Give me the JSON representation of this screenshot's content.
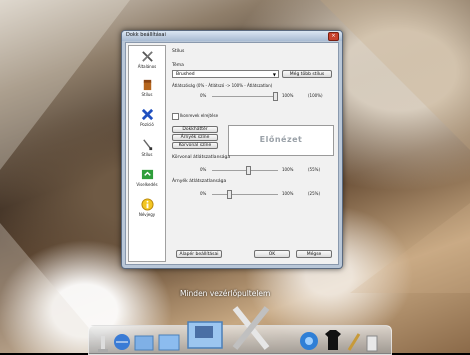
{
  "window": {
    "title": "Dokk beállításai",
    "close_glyph": "×"
  },
  "nav": [
    {
      "label": "Általános",
      "icon": "tools-icon"
    },
    {
      "label": "Stílus",
      "icon": "bucket-icon"
    },
    {
      "label": "Pozíció",
      "icon": "position-icon"
    },
    {
      "label": "Stílus",
      "icon": "brush-icon"
    },
    {
      "label": "Viselkedés",
      "icon": "behavior-icon"
    },
    {
      "label": "Névjegy",
      "icon": "info-icon"
    }
  ],
  "style": {
    "heading": "Stílus",
    "theme_label": "Téma",
    "theme_value": "Brushed",
    "more_styles": "Még több stílus",
    "opacity_label": "Átlátszóság (0% - Átlátszó -> 100% - Átlátszatlan)",
    "opacity_min": "0%",
    "opacity_max": "100%",
    "opacity_value": "(100%)",
    "opacity_fraction": 1.0,
    "dark_icons_label": "Ikonrevek elrejtése",
    "btn_background": "Dokkháttér",
    "btn_shadow": "Árnyék színe",
    "btn_separator": "Korvonal színe",
    "preview": "Előnézet",
    "separator_opacity_label": "Körvonal átlátszatlansága",
    "separator_min": "0%",
    "separator_max": "100%",
    "separator_value": "(55%)",
    "separator_fraction": 0.55,
    "shadow_opacity_label": "Árnyék átlátszatlansága",
    "shadow_min": "0%",
    "shadow_max": "100%",
    "shadow_value": "(25%)",
    "shadow_fraction": 0.25,
    "reset": "Alapér beállításai",
    "ok": "OK",
    "cancel": "Mégse"
  },
  "desktop": {
    "caption": "Minden vezérlőpultelem"
  }
}
